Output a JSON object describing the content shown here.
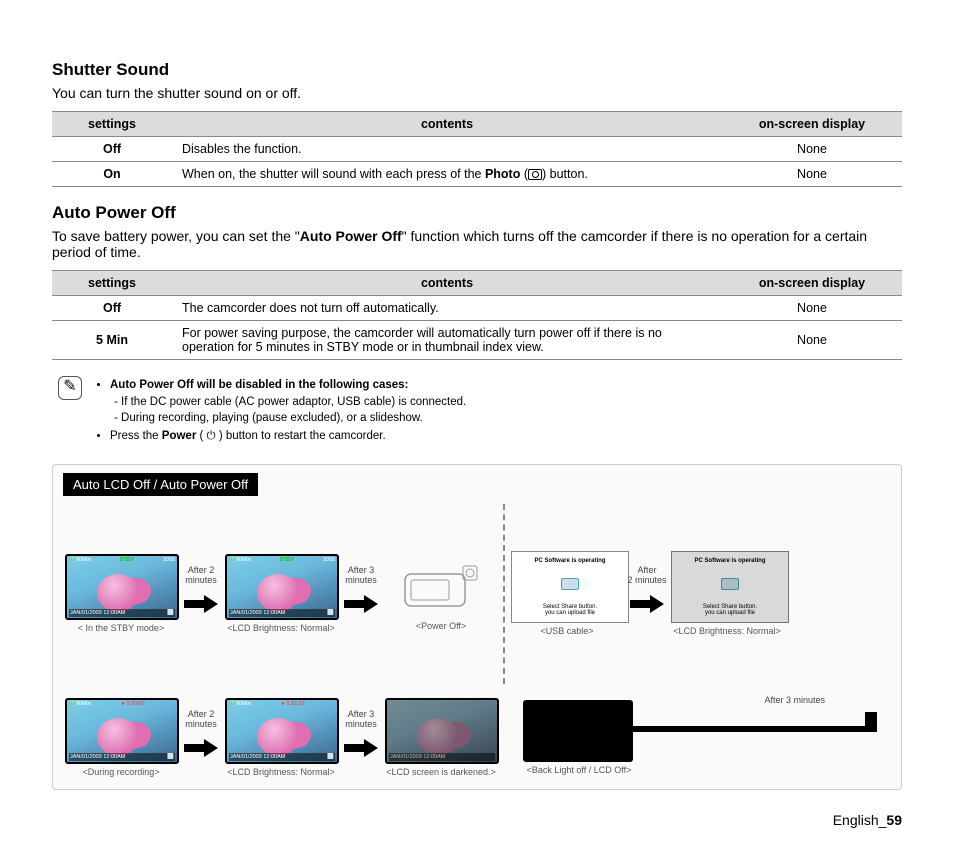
{
  "section1": {
    "title": "Shutter Sound",
    "desc": "You can turn the shutter sound on or off.",
    "headers": {
      "c1": "settings",
      "c2": "contents",
      "c3": "on-screen display"
    },
    "rows": [
      {
        "s": "Off",
        "c": "Disables the function.",
        "d": "None"
      },
      {
        "s": "On",
        "c_pre": "When on, the shutter will sound with each press of the ",
        "c_bold": "Photo",
        "c_post": " (",
        "c_end": ") button.",
        "d": "None"
      }
    ]
  },
  "section2": {
    "title": "Auto Power Off",
    "desc_pre": "To save battery power, you can set the \"",
    "desc_bold": "Auto Power Off",
    "desc_post": "\" function which turns off the camcorder if there is no operation for a certain period of time.",
    "headers": {
      "c1": "settings",
      "c2": "contents",
      "c3": "on-screen display"
    },
    "rows": [
      {
        "s": "Off",
        "c": "The camcorder does not turn off automatically.",
        "d": "None"
      },
      {
        "s": "5 Min",
        "c": "For power saving purpose, the camcorder will automatically turn power off if there is no operation for 5 minutes in STBY mode or in thumbnail index view.",
        "d": "None"
      }
    ]
  },
  "notes": {
    "b1": "Auto Power Off will be disabled in the following cases:",
    "l1": "If the DC power cable (AC power adaptor, USB cable) is connected.",
    "l2": "During recording, playing (pause excluded), or a slideshow.",
    "b2_pre": "Press the ",
    "b2_bold": "Power",
    "b2_post": " ( ",
    "b2_end": " ) button to restart the camcorder."
  },
  "diagram": {
    "title": "Auto LCD Off / Auto Power Off",
    "a2": "After 2 minutes",
    "a3": "After 3 minutes",
    "a2b": "After\n2 minutes",
    "r1": {
      "t1": {
        "tl": "90Min",
        "tm": "STBY",
        "tr": "3058",
        "bl": "JAN/01/2009 12:00AM",
        "cap": "< In the STBY mode>"
      },
      "t2": {
        "tl": "90Min",
        "tm": "STBY",
        "tr": "3058",
        "bl": "JAN/01/2009 12:00AM",
        "cap": "<LCD Brightness: Normal>"
      },
      "t3": {
        "cap": "<Power Off>"
      },
      "t4": {
        "cap": "<USB cable>",
        "pc": "PC Software is operating",
        "sel": "Select Share button.\nyou can upload file"
      },
      "t5": {
        "cap": "<LCD Brightness: Normal>",
        "pc": "PC Software is operating",
        "sel": "Select Share button.\nyou can upload file"
      }
    },
    "r2": {
      "t1": {
        "tl": "90Min",
        "tm": "0:00:00",
        "tr": "",
        "bl": "JAN/01/2009 12:00AM",
        "cap": "<During recording>"
      },
      "t2": {
        "tl": "90Min",
        "tm": "0:32:30",
        "tr": "",
        "bl": "JAN/01/2009 12:00AM",
        "cap": "<LCD Brightness: Normal>"
      },
      "t3": {
        "tl": "",
        "tm": "",
        "tr": "",
        "bl": "JAN/01/2009 12:00AM",
        "cap": "<LCD screen is darkened.>"
      },
      "t4": {
        "cap": "<Back Light off / LCD Off>"
      }
    },
    "back": "After 3 minutes"
  },
  "footer": {
    "lang": "English",
    "page": "59"
  }
}
